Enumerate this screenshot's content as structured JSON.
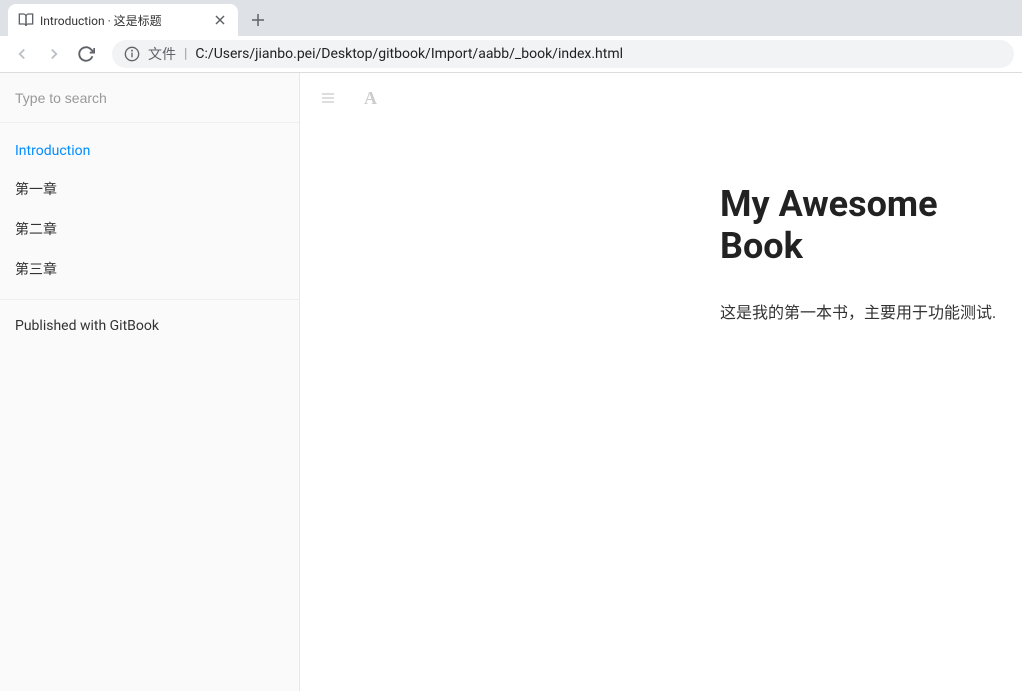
{
  "browser": {
    "tab_title": "Introduction · 这是标题",
    "address_label": "文件",
    "address_url": "C:/Users/jianbo.pei/Desktop/gitbook/Import/aabb/_book/index.html"
  },
  "sidebar": {
    "search_placeholder": "Type to search",
    "items": [
      {
        "label": "Introduction",
        "active": true
      },
      {
        "label": "第一章",
        "active": false
      },
      {
        "label": "第二章",
        "active": false
      },
      {
        "label": "第三章",
        "active": false
      }
    ],
    "publish_label": "Published with GitBook"
  },
  "content": {
    "title": "My Awesome Book",
    "intro": "这是我的第一本书，主要用于功能测试."
  }
}
